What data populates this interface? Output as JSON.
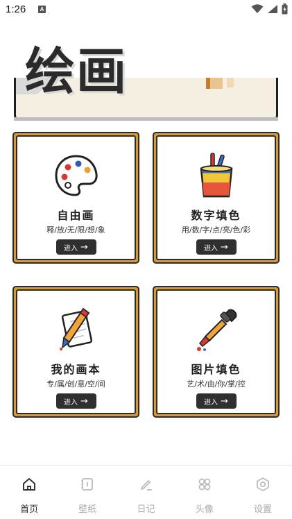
{
  "status_bar": {
    "time": "1:26",
    "notification_letter": "A"
  },
  "banner": {
    "title": "绘画"
  },
  "cards": [
    {
      "title": "自由画",
      "subtitle": "释/放/无/限/想/象",
      "button": "进入",
      "icon": "palette-icon"
    },
    {
      "title": "数字填色",
      "subtitle": "用/数/字/点/亮/色/彩",
      "button": "进入",
      "icon": "paint-bucket-icon"
    },
    {
      "title": "我的画本",
      "subtitle": "专/属/创/意/空/间",
      "button": "进入",
      "icon": "pen-notebook-icon"
    },
    {
      "title": "图片填色",
      "subtitle": "艺/术/由/你/掌/控",
      "button": "进入",
      "icon": "dropper-icon"
    }
  ],
  "nav": {
    "items": [
      {
        "label": "首页",
        "icon": "home-icon",
        "active": true
      },
      {
        "label": "壁纸",
        "icon": "wallpaper-icon",
        "active": false
      },
      {
        "label": "日记",
        "icon": "edit-icon",
        "active": false
      },
      {
        "label": "头像",
        "icon": "grid-icon",
        "active": false
      },
      {
        "label": "设置",
        "icon": "settings-icon",
        "active": false
      }
    ]
  },
  "colors": {
    "card_border": "#d49a3a",
    "dark": "#2f2f2f",
    "nav_active": "#333333",
    "nav_inactive": "#aaaaaa"
  }
}
